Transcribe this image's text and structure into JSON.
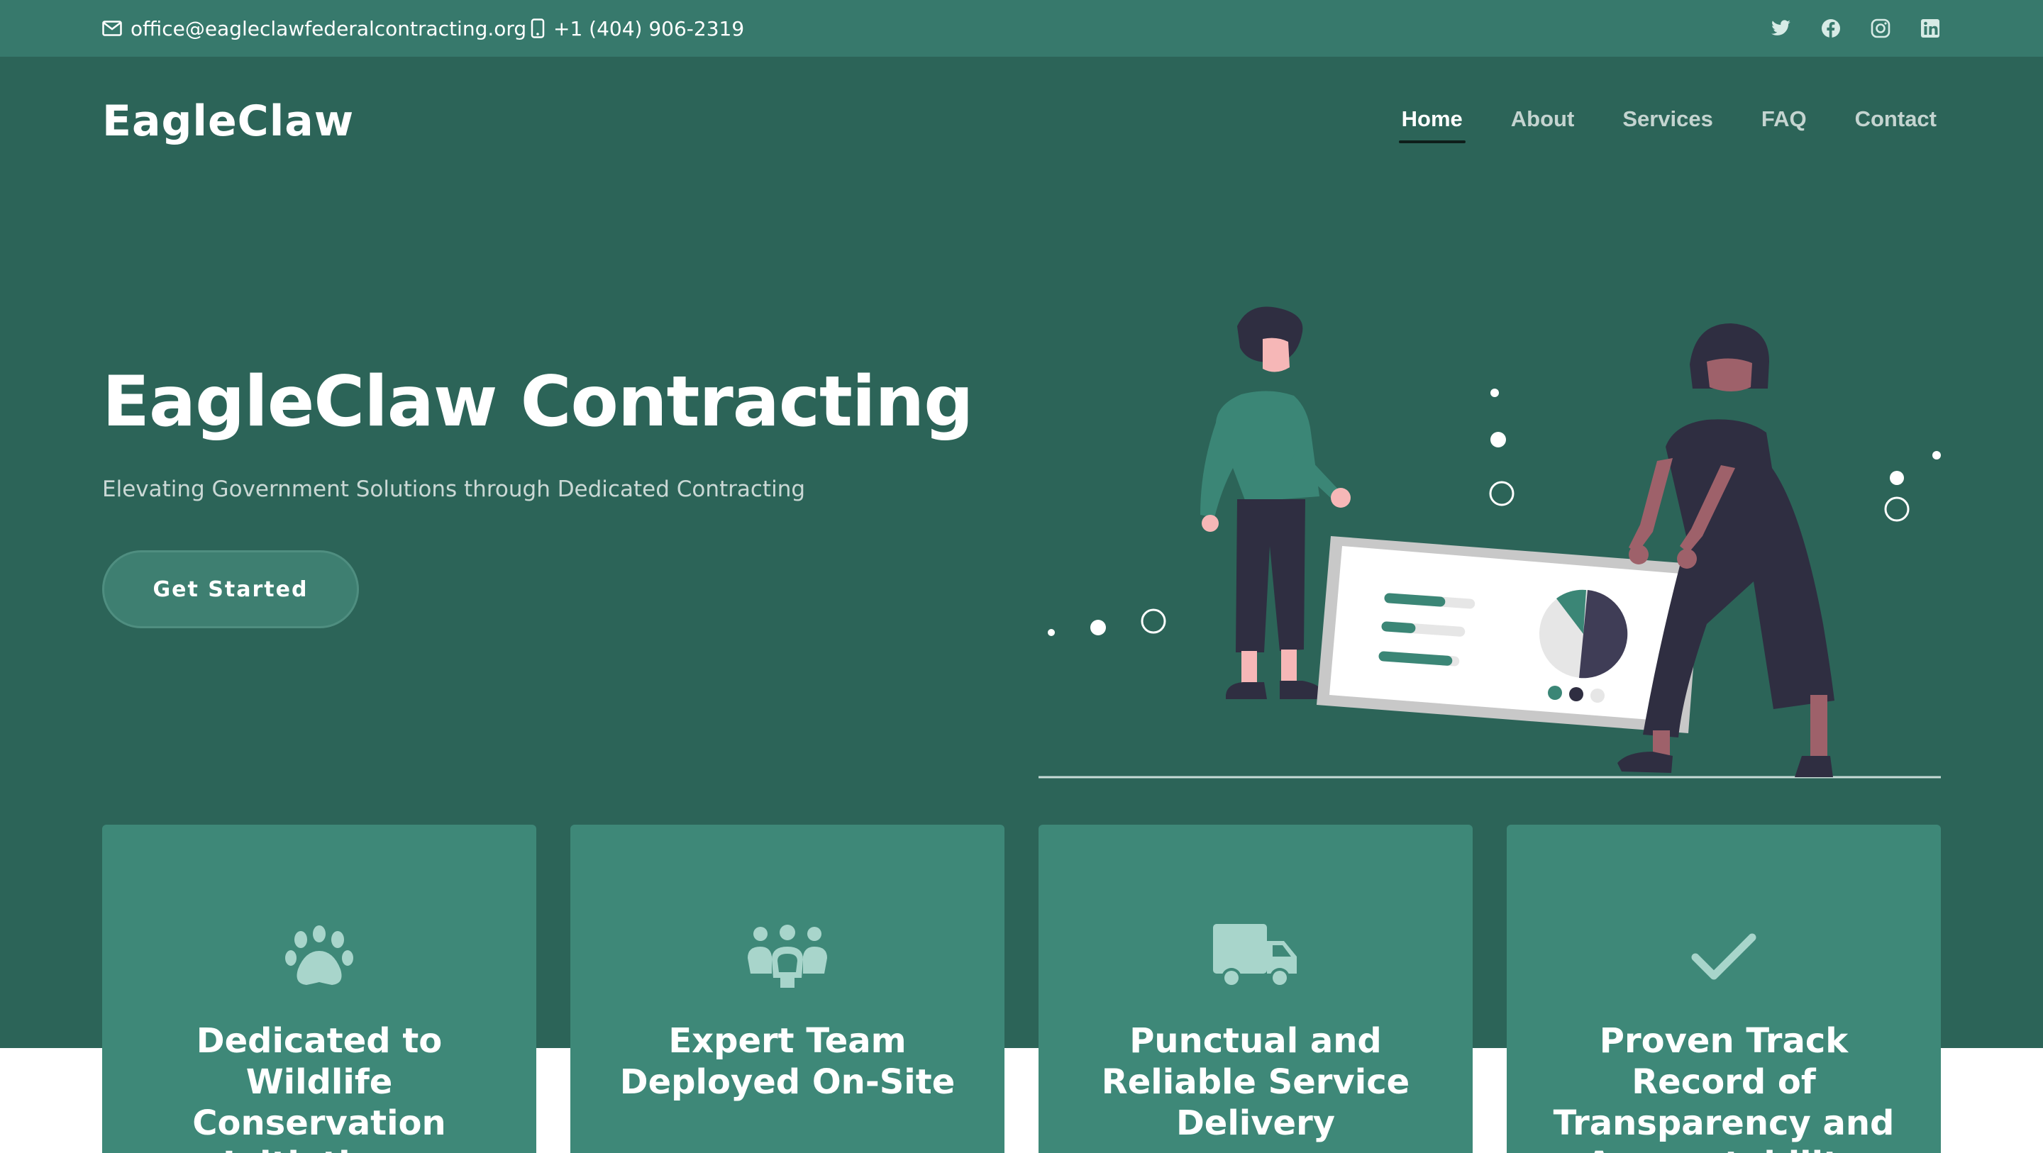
{
  "topbar": {
    "email": "office@eagleclawfederalcontracting.org",
    "phone": "+1 (404) 906-2319",
    "socials": [
      "twitter-icon",
      "facebook-icon",
      "instagram-icon",
      "linkedin-icon"
    ]
  },
  "header": {
    "logo": "EagleClaw",
    "nav": [
      {
        "label": "Home",
        "active": true
      },
      {
        "label": "About"
      },
      {
        "label": "Services"
      },
      {
        "label": "FAQ"
      },
      {
        "label": "Contact"
      }
    ]
  },
  "hero": {
    "title": "EagleClaw Contracting",
    "subtitle": "Elevating Government Solutions through Dedicated Contracting",
    "cta_label": "Get Started"
  },
  "features": [
    {
      "icon": "paw-icon",
      "title": "Dedicated to Wildlife Conservation Initiatives"
    },
    {
      "icon": "team-icon",
      "title": "Expert Team Deployed On-Site"
    },
    {
      "icon": "truck-icon",
      "title": "Punctual and Reliable Service Delivery"
    },
    {
      "icon": "check-icon",
      "title": "Proven Track Record of Transparency and Accountability"
    }
  ],
  "colors": {
    "topbar": "#37796c",
    "hero_bg": "#2c6458",
    "card_bg": "#3e8878",
    "icon_tint": "#a8d5cb"
  }
}
